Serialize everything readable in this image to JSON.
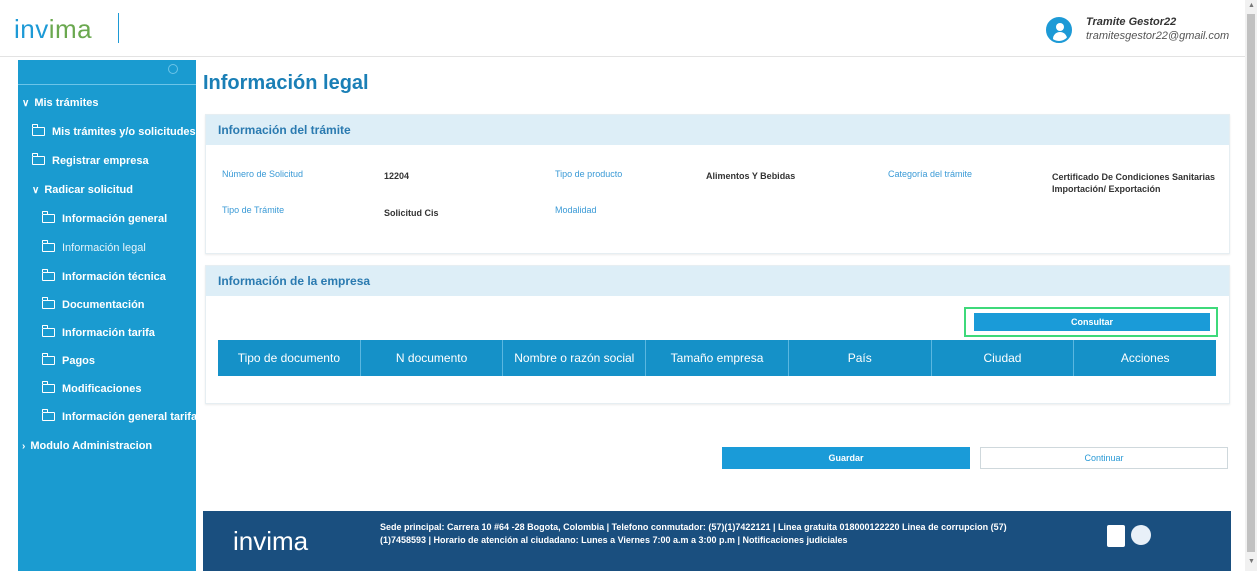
{
  "header": {
    "logo_main": "inv",
    "logo_accent": "ima",
    "user_name": "Tramite Gestor22",
    "user_email": "tramitesgestor22@gmail.com"
  },
  "sidebar": {
    "search_icon": "search-icon",
    "items": [
      {
        "label": "Mis trámites",
        "icon": "chevron-down-icon",
        "level": 0
      },
      {
        "label": "Mis trámites y/o solicitudes",
        "icon": "folder-icon",
        "level": 1
      },
      {
        "label": "Registrar empresa",
        "icon": "folder-icon",
        "level": 1
      },
      {
        "label": "Radicar solicitud",
        "icon": "chevron-down-icon",
        "level": 1
      },
      {
        "label": "Información general",
        "icon": "folder-icon",
        "level": 2
      },
      {
        "label": "Información legal",
        "icon": "folder-icon",
        "level": 2,
        "active": true
      },
      {
        "label": "Información técnica",
        "icon": "folder-icon",
        "level": 2
      },
      {
        "label": "Documentación",
        "icon": "folder-icon",
        "level": 2
      },
      {
        "label": "Información tarifa",
        "icon": "folder-icon",
        "level": 2
      },
      {
        "label": "Pagos",
        "icon": "folder-icon",
        "level": 2
      },
      {
        "label": "Modificaciones",
        "icon": "folder-icon",
        "level": 2
      },
      {
        "label": "Información general tarifa",
        "icon": "folder-icon",
        "level": 2
      },
      {
        "label": "Modulo Administracion",
        "icon": "chevron-right-icon",
        "level": 0
      }
    ]
  },
  "main": {
    "title": "Información legal",
    "tramite": {
      "heading": "Información del trámite",
      "numero_label": "Número de Solicitud",
      "numero_value": "12204",
      "tipo_producto_label": "Tipo de producto",
      "tipo_producto_value": "Alimentos Y Bebidas",
      "categoria_label": "Categoría del trámite",
      "categoria_value_line1": "Certificado De Condiciones Sanitarias",
      "categoria_value_line2": "Importación/ Exportación",
      "tipo_tramite_label": "Tipo de Trámite",
      "tipo_tramite_value": "Solicitud Cis",
      "modalidad_label": "Modalidad"
    },
    "empresa": {
      "heading": "Información de la empresa",
      "consultar_label": "Consultar",
      "columns": [
        "Tipo de documento",
        "N documento",
        "Nombre o razón social",
        "Tamaño empresa",
        "País",
        "Ciudad",
        "Acciones"
      ]
    },
    "actions": {
      "guardar": "Guardar",
      "continuar": "Continuar"
    }
  },
  "footer": {
    "logo": "invima",
    "text": "Sede principal: Carrera 10 #64 -28 Bogota, Colombia | Telefono conmutador: (57)(1)7422121 | Linea gratuita 018000122220 Linea de corrupcion (57)(1)7458593 | Horario de atención al ciudadano: Lunes a Viernes 7:00 a.m a 3:00 p.m | Notificaciones judiciales"
  },
  "colors": {
    "brand_blue": "#1a9bd0",
    "title_blue": "#1a7fb6",
    "footer_navy": "#1a4f7f",
    "highlight_green": "#3ed97a"
  }
}
